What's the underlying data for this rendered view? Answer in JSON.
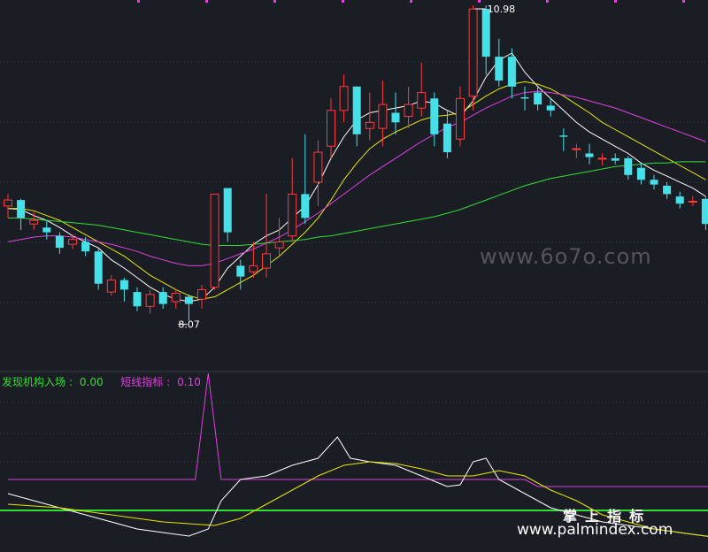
{
  "chart_data": {
    "type": "candlestick",
    "annotations": {
      "high_label": "10.98",
      "low_label": "8.07"
    },
    "candles": [
      [
        9.3,
        9.35,
        9.4,
        9.2
      ],
      [
        9.35,
        9.2,
        9.36,
        9.1
      ],
      [
        9.15,
        9.18,
        9.25,
        9.1
      ],
      [
        9.12,
        9.08,
        9.18,
        9.02
      ],
      [
        9.05,
        8.95,
        9.08,
        8.9
      ],
      [
        8.98,
        9.02,
        9.06,
        8.94
      ],
      [
        9.0,
        8.92,
        9.04,
        8.88
      ],
      [
        8.92,
        8.65,
        8.95,
        8.6
      ],
      [
        8.58,
        8.68,
        8.72,
        8.55
      ],
      [
        8.68,
        8.6,
        8.7,
        8.5
      ],
      [
        8.58,
        8.46,
        8.62,
        8.42
      ],
      [
        8.46,
        8.56,
        8.6,
        8.4
      ],
      [
        8.58,
        8.48,
        8.62,
        8.44
      ],
      [
        8.5,
        8.57,
        8.6,
        8.44
      ],
      [
        8.54,
        8.48,
        8.56,
        8.34
      ],
      [
        8.52,
        8.6,
        8.64,
        8.44
      ],
      [
        8.62,
        9.4,
        9.4,
        8.6
      ],
      [
        9.45,
        9.08,
        9.45,
        9.0
      ],
      [
        8.8,
        8.71,
        8.85,
        8.6
      ],
      [
        8.75,
        8.8,
        9.0,
        8.7
      ],
      [
        8.78,
        8.9,
        9.4,
        8.7
      ],
      [
        8.95,
        9.0,
        9.2,
        8.88
      ],
      [
        9.05,
        9.4,
        9.7,
        9.0
      ],
      [
        9.4,
        9.2,
        9.9,
        9.15
      ],
      [
        9.5,
        9.75,
        9.85,
        9.3
      ],
      [
        9.8,
        10.1,
        10.2,
        9.7
      ],
      [
        10.1,
        10.3,
        10.4,
        10.0
      ],
      [
        10.3,
        9.9,
        10.3,
        9.8
      ],
      [
        9.95,
        10.0,
        10.25,
        9.85
      ],
      [
        9.95,
        10.15,
        10.35,
        9.8
      ],
      [
        10.08,
        10.0,
        10.25,
        9.9
      ],
      [
        10.05,
        10.15,
        10.3,
        9.95
      ],
      [
        10.12,
        10.25,
        10.5,
        10.05
      ],
      [
        10.2,
        9.9,
        10.25,
        9.8
      ],
      [
        9.99,
        9.75,
        10.1,
        9.7
      ],
      [
        9.86,
        10.2,
        10.3,
        9.8
      ],
      [
        10.22,
        10.95,
        10.98,
        10.1
      ],
      [
        10.95,
        10.55,
        10.98,
        10.4
      ],
      [
        10.55,
        10.35,
        10.7,
        10.3
      ],
      [
        10.55,
        10.3,
        10.62,
        10.2
      ],
      [
        10.21,
        10.2,
        10.3,
        10.1
      ],
      [
        10.25,
        10.15,
        10.3,
        10.1
      ],
      [
        10.14,
        10.1,
        10.2,
        10.05
      ],
      [
        9.89,
        9.88,
        9.95,
        9.76
      ],
      [
        9.78,
        9.78,
        9.82,
        9.7
      ],
      [
        9.74,
        9.71,
        9.82,
        9.65
      ],
      [
        9.7,
        9.7,
        9.74,
        9.64
      ],
      [
        9.7,
        9.68,
        9.74,
        9.65
      ],
      [
        9.7,
        9.56,
        9.72,
        9.52
      ],
      [
        9.62,
        9.52,
        9.66,
        9.48
      ],
      [
        9.52,
        9.48,
        9.56,
        9.44
      ],
      [
        9.47,
        9.4,
        9.5,
        9.36
      ],
      [
        9.38,
        9.32,
        9.42,
        9.28
      ],
      [
        9.34,
        9.34,
        9.38,
        9.3
      ],
      [
        9.36,
        9.15,
        9.38,
        9.1
      ]
    ],
    "moving_averages": [
      {
        "color": "#ffffff",
        "values": [
          9.28,
          9.27,
          9.22,
          9.18,
          9.12,
          9.05,
          9.0,
          8.95,
          8.85,
          8.78,
          8.7,
          8.62,
          8.56,
          8.52,
          8.5,
          8.52,
          8.62,
          8.78,
          8.88,
          8.98,
          9.05,
          9.1,
          9.2,
          9.3,
          9.48,
          9.7,
          9.88,
          10.02,
          10.08,
          10.1,
          10.12,
          10.14,
          10.18,
          10.16,
          10.1,
          10.05,
          10.18,
          10.38,
          10.52,
          10.58,
          10.42,
          10.3,
          10.2,
          10.1,
          10.0,
          9.92,
          9.86,
          9.8,
          9.74,
          9.66,
          9.6,
          9.55,
          9.5,
          9.45,
          9.38
        ]
      },
      {
        "color": "#e8e800",
        "values": [
          9.28,
          9.28,
          9.26,
          9.22,
          9.18,
          9.12,
          9.06,
          9.0,
          8.94,
          8.88,
          8.8,
          8.72,
          8.66,
          8.6,
          8.55,
          8.52,
          8.54,
          8.6,
          8.66,
          8.72,
          8.8,
          8.88,
          8.98,
          9.08,
          9.2,
          9.35,
          9.52,
          9.66,
          9.78,
          9.86,
          9.92,
          9.97,
          10.02,
          10.05,
          10.06,
          10.08,
          10.15,
          10.22,
          10.28,
          10.32,
          10.34,
          10.32,
          10.28,
          10.22,
          10.15,
          10.08,
          10.0,
          9.94,
          9.88,
          9.82,
          9.76,
          9.7,
          9.64,
          9.58,
          9.52
        ]
      },
      {
        "color": "#e040e0",
        "values": [
          9.0,
          9.02,
          9.04,
          9.05,
          9.05,
          9.04,
          9.02,
          9.0,
          8.98,
          8.95,
          8.92,
          8.88,
          8.85,
          8.82,
          8.8,
          8.8,
          8.82,
          8.86,
          8.9,
          8.94,
          8.99,
          9.04,
          9.1,
          9.17,
          9.24,
          9.32,
          9.4,
          9.48,
          9.56,
          9.63,
          9.7,
          9.77,
          9.84,
          9.9,
          9.96,
          10.0,
          10.06,
          10.12,
          10.17,
          10.22,
          10.25,
          10.26,
          10.25,
          10.23,
          10.21,
          10.18,
          10.15,
          10.12,
          10.08,
          10.04,
          10.0,
          9.96,
          9.92,
          9.88,
          9.84
        ]
      },
      {
        "color": "#33dd33",
        "values": [
          9.2,
          9.2,
          9.19,
          9.18,
          9.17,
          9.16,
          9.15,
          9.14,
          9.12,
          9.1,
          9.08,
          9.06,
          9.04,
          9.02,
          9.0,
          8.98,
          8.97,
          8.97,
          8.97,
          8.98,
          8.99,
          9.0,
          9.01,
          9.02,
          9.04,
          9.05,
          9.07,
          9.09,
          9.11,
          9.13,
          9.15,
          9.17,
          9.19,
          9.21,
          9.24,
          9.27,
          9.31,
          9.35,
          9.39,
          9.43,
          9.47,
          9.5,
          9.53,
          9.55,
          9.57,
          9.59,
          9.61,
          9.63,
          9.64,
          9.65,
          9.66,
          9.66,
          9.67,
          9.67,
          9.67
        ]
      }
    ],
    "indicators": {
      "series": [
        {
          "name": "发现机构入场",
          "value_label": "0.00",
          "color": "#33dd33"
        },
        {
          "name": "短线指标",
          "value_label": "0.10",
          "color": "#e040e0"
        }
      ],
      "lines": [
        {
          "color": "#e040e0",
          "points": [
            [
              0,
              12
            ],
            [
              14.5,
              12
            ],
            [
              15.5,
              42
            ],
            [
              16.5,
              12
            ],
            [
              40,
              12
            ],
            [
              41,
              10
            ],
            [
              56,
              10
            ]
          ]
        },
        {
          "color": "#ffffff",
          "points": [
            [
              0,
              8
            ],
            [
              2,
              6
            ],
            [
              4,
              4
            ],
            [
              6,
              2
            ],
            [
              8,
              0
            ],
            [
              10,
              -2
            ],
            [
              12,
              -3
            ],
            [
              14,
              -4
            ],
            [
              15.5,
              -2
            ],
            [
              16.5,
              6
            ],
            [
              18,
              12
            ],
            [
              20,
              13
            ],
            [
              22,
              16
            ],
            [
              24,
              18
            ],
            [
              25.5,
              24
            ],
            [
              26.5,
              18
            ],
            [
              28,
              17
            ],
            [
              30,
              16
            ],
            [
              32,
              13
            ],
            [
              34,
              10
            ],
            [
              35,
              10.5
            ],
            [
              36,
              17
            ],
            [
              37,
              18
            ],
            [
              38,
              12
            ],
            [
              40,
              8
            ],
            [
              42,
              4
            ],
            [
              44,
              2
            ],
            [
              46,
              0
            ],
            [
              48,
              -1
            ],
            [
              50,
              -2
            ],
            [
              52,
              -3
            ],
            [
              54,
              -4
            ],
            [
              56,
              -5
            ]
          ]
        },
        {
          "color": "#e8e800",
          "points": [
            [
              0,
              5
            ],
            [
              4,
              4
            ],
            [
              8,
              2
            ],
            [
              12,
              0
            ],
            [
              16,
              -1
            ],
            [
              18,
              1
            ],
            [
              20,
              5
            ],
            [
              22,
              9
            ],
            [
              24,
              13
            ],
            [
              26,
              16
            ],
            [
              28,
              17
            ],
            [
              30,
              16.5
            ],
            [
              32,
              15
            ],
            [
              34,
              13
            ],
            [
              36,
              13
            ],
            [
              38,
              14.5
            ],
            [
              40,
              13
            ],
            [
              42,
              9
            ],
            [
              44,
              6
            ],
            [
              46,
              2
            ],
            [
              48,
              0
            ],
            [
              50,
              -2
            ],
            [
              52,
              -3
            ],
            [
              54,
              -4
            ],
            [
              56,
              -4
            ]
          ]
        }
      ]
    }
  },
  "watermarks": {
    "site1": "www.6o7o.com",
    "cn": "掌上指标",
    "site2": "www.palmindex.com"
  },
  "colors": {
    "up": "#ff3b3b",
    "down": "#46e0e8",
    "bg": "#1b1d24"
  }
}
